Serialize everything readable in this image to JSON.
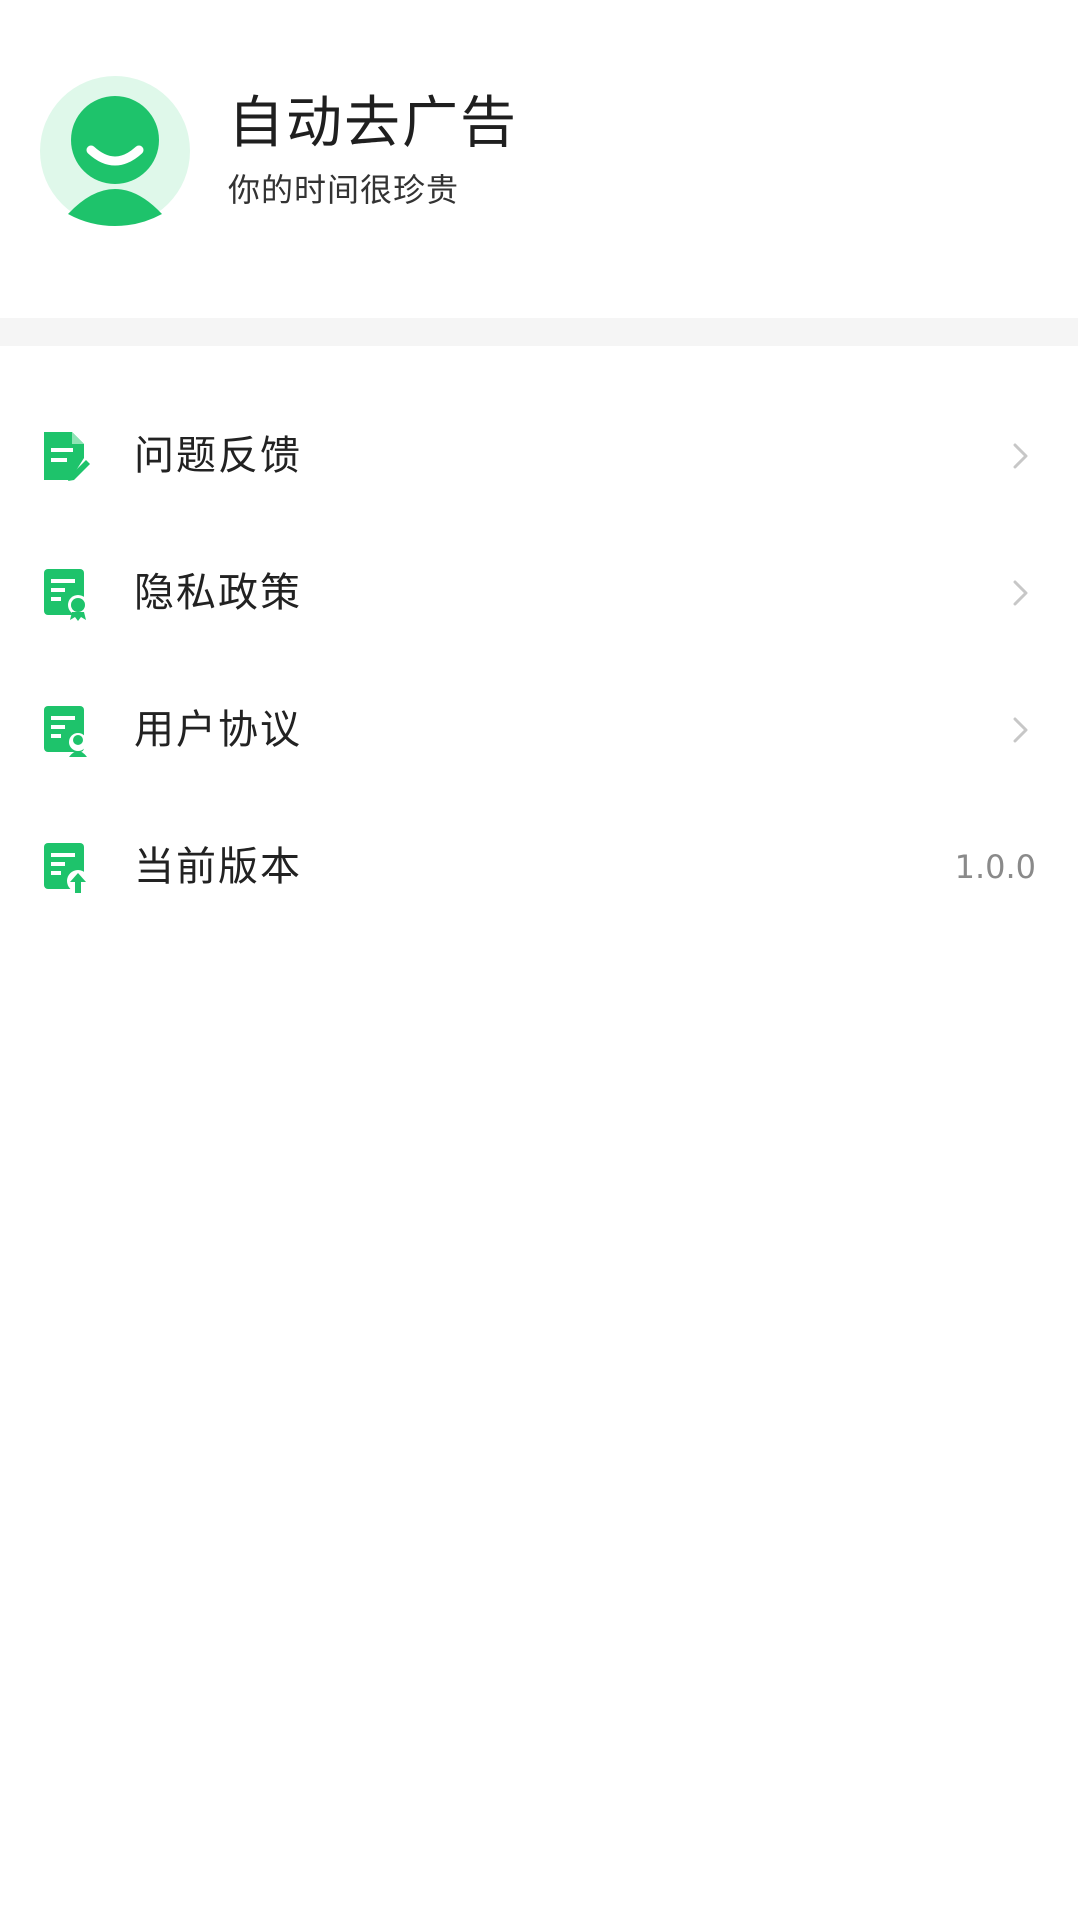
{
  "profile": {
    "app_name": "自动去广告",
    "slogan": "你的时间很珍贵",
    "avatar_icon": "smiley-user-icon"
  },
  "menu": {
    "items": [
      {
        "label": "问题反馈",
        "icon": "feedback-document-icon",
        "trailing": "chevron-right-icon"
      },
      {
        "label": "隐私政策",
        "icon": "privacy-document-icon",
        "trailing": "chevron-right-icon"
      },
      {
        "label": "用户协议",
        "icon": "agreement-document-icon",
        "trailing": "chevron-right-icon"
      },
      {
        "label": "当前版本",
        "icon": "version-upload-icon",
        "value": "1.0.0"
      }
    ]
  },
  "colors": {
    "accent": "#1ec36b",
    "accent_light": "#dff8ea",
    "divider_band": "#f5f5f5",
    "chevron": "#c7c7c7",
    "secondary_text": "#8a8a8a"
  }
}
